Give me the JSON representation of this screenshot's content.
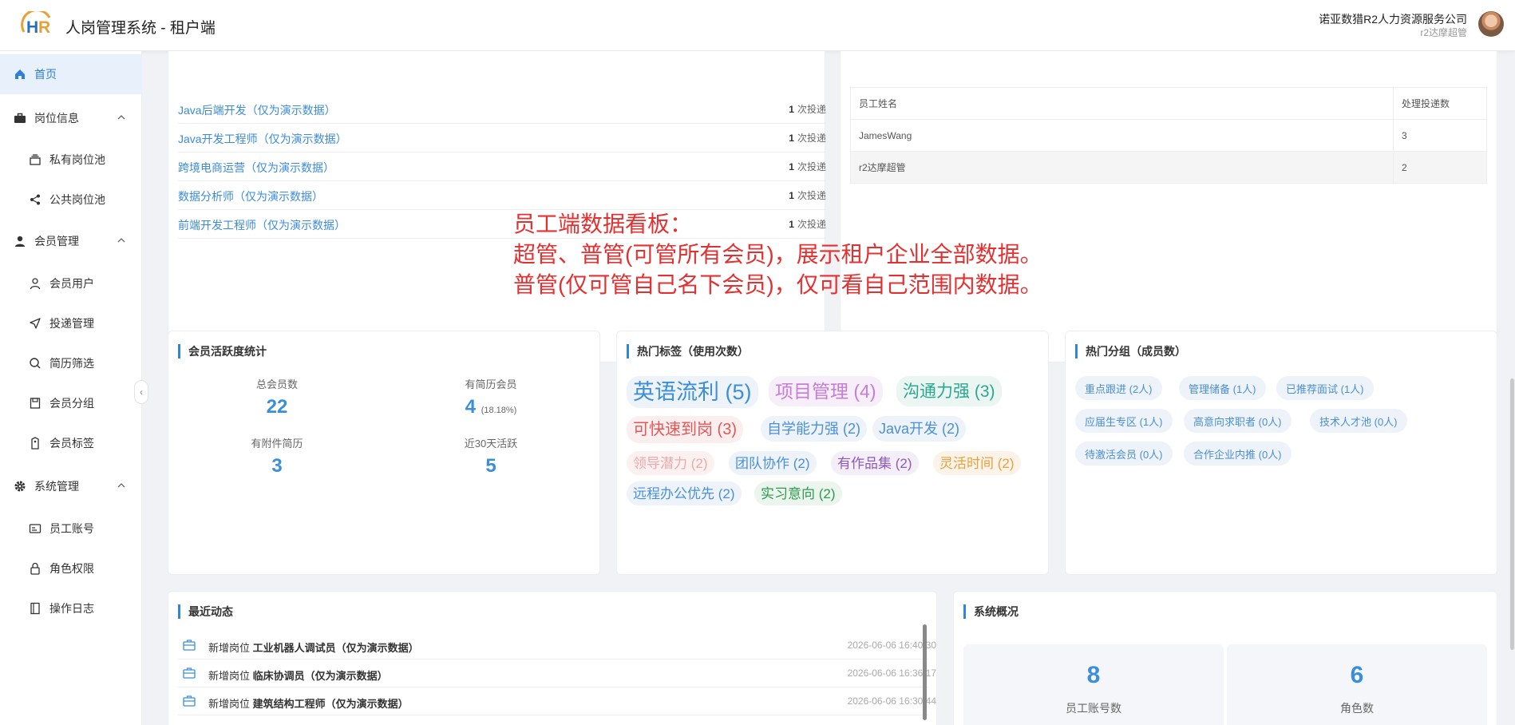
{
  "header": {
    "logo_text": "HR",
    "title": "人岗管理系统 - 租户端",
    "company": "诺亚数猎R2人力资源服务公司",
    "user_role": "r2达摩超管"
  },
  "sidebar": {
    "items": [
      {
        "label": "首页",
        "icon": "home-icon"
      },
      {
        "label": "岗位信息",
        "icon": "briefcase-icon"
      },
      {
        "label": "私有岗位池",
        "icon": "stack-icon"
      },
      {
        "label": "公共岗位池",
        "icon": "share-icon"
      },
      {
        "label": "会员管理",
        "icon": "person-icon"
      },
      {
        "label": "会员用户",
        "icon": "user-outline-icon"
      },
      {
        "label": "投递管理",
        "icon": "send-icon"
      },
      {
        "label": "简历筛选",
        "icon": "search-icon"
      },
      {
        "label": "会员分组",
        "icon": "save-icon"
      },
      {
        "label": "会员标签",
        "icon": "tag-icon"
      },
      {
        "label": "系统管理",
        "icon": "gear-icon"
      },
      {
        "label": "员工账号",
        "icon": "id-card-icon"
      },
      {
        "label": "角色权限",
        "icon": "lock-icon"
      },
      {
        "label": "操作日志",
        "icon": "log-icon"
      }
    ]
  },
  "jobs": {
    "rows": [
      {
        "name": "Java后端开发（仅为演示数据）",
        "count": "1",
        "unit": "次投递"
      },
      {
        "name": "Java开发工程师（仅为演示数据）",
        "count": "1",
        "unit": "次投递"
      },
      {
        "name": "跨境电商运营（仅为演示数据）",
        "count": "1",
        "unit": "次投递"
      },
      {
        "name": "数据分析师（仅为演示数据）",
        "count": "1",
        "unit": "次投递"
      },
      {
        "name": "前端开发工程师（仅为演示数据）",
        "count": "1",
        "unit": "次投递"
      }
    ]
  },
  "staff_table": {
    "headers": [
      "员工姓名",
      "处理投递数"
    ],
    "rows": [
      {
        "name": "JamesWang",
        "count": "3"
      },
      {
        "name": "r2达摩超管",
        "count": "2"
      }
    ]
  },
  "activity_stats": {
    "title": "会员活跃度统计",
    "total_label": "总会员数",
    "total": "22",
    "resume_label": "有简历会员",
    "resume": "4",
    "resume_pct": "(18.18%)",
    "attach_label": "有附件简历",
    "attach": "3",
    "active_label": "近30天活跃",
    "active": "5"
  },
  "hot_tags": {
    "title": "热门标签（使用次数）",
    "tags": [
      {
        "text": "英语流利 (5)",
        "color": "#3b8fd9"
      },
      {
        "text": "项目管理 (4)",
        "color": "#c77dd6"
      },
      {
        "text": "沟通力强 (3)",
        "color": "#2aa890"
      },
      {
        "text": "可快速到岗 (3)",
        "color": "#e05858"
      },
      {
        "text": "自学能力强 (2)",
        "color": "#4a90d9"
      },
      {
        "text": "Java开发 (2)",
        "color": "#4a90d9"
      },
      {
        "text": "领导潜力 (2)",
        "color": "#f0a8a8"
      },
      {
        "text": "团队协作 (2)",
        "color": "#4a90d9"
      },
      {
        "text": "有作品集 (2)",
        "color": "#8e5bb8"
      },
      {
        "text": "灵活时间 (2)",
        "color": "#e8a040"
      },
      {
        "text": "远程办公优先 (2)",
        "color": "#4a90d9"
      },
      {
        "text": "实习意向 (2)",
        "color": "#2e9a4e"
      }
    ]
  },
  "hot_groups": {
    "title": "热门分组（成员数）",
    "groups": [
      "重点跟进 (2人)",
      "管理储备 (1人)",
      "已推荐面试 (1人)",
      "应届生专区 (1人)",
      "高意向求职者 (0人)",
      "技术人才池 (0人)",
      "待激活会员 (0人)",
      "合作企业内推 (0人)"
    ]
  },
  "recent": {
    "title": "最近动态",
    "rows": [
      {
        "prefix": "新增岗位",
        "name": "工业机器人调试员（仅为演示数据）",
        "time": "2026-06-06 16:40:30"
      },
      {
        "prefix": "新增岗位",
        "name": "临床协调员（仅为演示数据）",
        "time": "2026-06-06 16:36:17"
      },
      {
        "prefix": "新增岗位",
        "name": "建筑结构工程师（仅为演示数据）",
        "time": "2026-06-06 16:30:44"
      }
    ]
  },
  "overview": {
    "title": "系统概况",
    "items": [
      {
        "num": "8",
        "label": "员工账号数"
      },
      {
        "num": "6",
        "label": "角色数"
      }
    ]
  },
  "annotation": {
    "line1": "员工端数据看板：",
    "line2": "超管、普管(可管所有会员)，展示租户企业全部数据。",
    "line3": "普管(仅可管自己名下会员)，仅可看自己范围内数据。"
  },
  "colors": {
    "accent": "#2e86de",
    "annotation": "#e33030"
  }
}
